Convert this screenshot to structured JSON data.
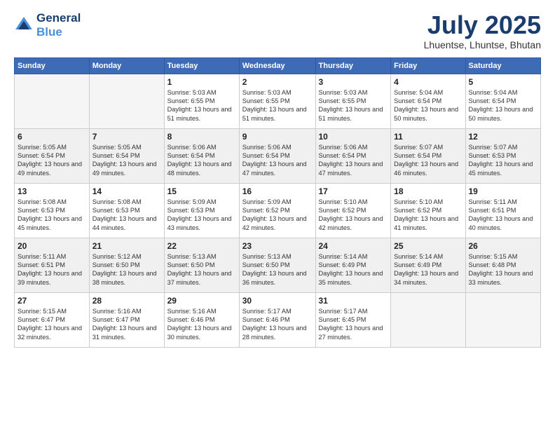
{
  "logo": {
    "line1": "General",
    "line2": "Blue"
  },
  "title": {
    "month_year": "July 2025",
    "location": "Lhuentse, Lhuntse, Bhutan"
  },
  "weekdays": [
    "Sunday",
    "Monday",
    "Tuesday",
    "Wednesday",
    "Thursday",
    "Friday",
    "Saturday"
  ],
  "weeks": [
    [
      {
        "day": "",
        "info": ""
      },
      {
        "day": "",
        "info": ""
      },
      {
        "day": "1",
        "info": "Sunrise: 5:03 AM\nSunset: 6:55 PM\nDaylight: 13 hours and 51 minutes."
      },
      {
        "day": "2",
        "info": "Sunrise: 5:03 AM\nSunset: 6:55 PM\nDaylight: 13 hours and 51 minutes."
      },
      {
        "day": "3",
        "info": "Sunrise: 5:03 AM\nSunset: 6:55 PM\nDaylight: 13 hours and 51 minutes."
      },
      {
        "day": "4",
        "info": "Sunrise: 5:04 AM\nSunset: 6:54 PM\nDaylight: 13 hours and 50 minutes."
      },
      {
        "day": "5",
        "info": "Sunrise: 5:04 AM\nSunset: 6:54 PM\nDaylight: 13 hours and 50 minutes."
      }
    ],
    [
      {
        "day": "6",
        "info": "Sunrise: 5:05 AM\nSunset: 6:54 PM\nDaylight: 13 hours and 49 minutes."
      },
      {
        "day": "7",
        "info": "Sunrise: 5:05 AM\nSunset: 6:54 PM\nDaylight: 13 hours and 49 minutes."
      },
      {
        "day": "8",
        "info": "Sunrise: 5:06 AM\nSunset: 6:54 PM\nDaylight: 13 hours and 48 minutes."
      },
      {
        "day": "9",
        "info": "Sunrise: 5:06 AM\nSunset: 6:54 PM\nDaylight: 13 hours and 47 minutes."
      },
      {
        "day": "10",
        "info": "Sunrise: 5:06 AM\nSunset: 6:54 PM\nDaylight: 13 hours and 47 minutes."
      },
      {
        "day": "11",
        "info": "Sunrise: 5:07 AM\nSunset: 6:54 PM\nDaylight: 13 hours and 46 minutes."
      },
      {
        "day": "12",
        "info": "Sunrise: 5:07 AM\nSunset: 6:53 PM\nDaylight: 13 hours and 45 minutes."
      }
    ],
    [
      {
        "day": "13",
        "info": "Sunrise: 5:08 AM\nSunset: 6:53 PM\nDaylight: 13 hours and 45 minutes."
      },
      {
        "day": "14",
        "info": "Sunrise: 5:08 AM\nSunset: 6:53 PM\nDaylight: 13 hours and 44 minutes."
      },
      {
        "day": "15",
        "info": "Sunrise: 5:09 AM\nSunset: 6:53 PM\nDaylight: 13 hours and 43 minutes."
      },
      {
        "day": "16",
        "info": "Sunrise: 5:09 AM\nSunset: 6:52 PM\nDaylight: 13 hours and 42 minutes."
      },
      {
        "day": "17",
        "info": "Sunrise: 5:10 AM\nSunset: 6:52 PM\nDaylight: 13 hours and 42 minutes."
      },
      {
        "day": "18",
        "info": "Sunrise: 5:10 AM\nSunset: 6:52 PM\nDaylight: 13 hours and 41 minutes."
      },
      {
        "day": "19",
        "info": "Sunrise: 5:11 AM\nSunset: 6:51 PM\nDaylight: 13 hours and 40 minutes."
      }
    ],
    [
      {
        "day": "20",
        "info": "Sunrise: 5:11 AM\nSunset: 6:51 PM\nDaylight: 13 hours and 39 minutes."
      },
      {
        "day": "21",
        "info": "Sunrise: 5:12 AM\nSunset: 6:50 PM\nDaylight: 13 hours and 38 minutes."
      },
      {
        "day": "22",
        "info": "Sunrise: 5:13 AM\nSunset: 6:50 PM\nDaylight: 13 hours and 37 minutes."
      },
      {
        "day": "23",
        "info": "Sunrise: 5:13 AM\nSunset: 6:50 PM\nDaylight: 13 hours and 36 minutes."
      },
      {
        "day": "24",
        "info": "Sunrise: 5:14 AM\nSunset: 6:49 PM\nDaylight: 13 hours and 35 minutes."
      },
      {
        "day": "25",
        "info": "Sunrise: 5:14 AM\nSunset: 6:49 PM\nDaylight: 13 hours and 34 minutes."
      },
      {
        "day": "26",
        "info": "Sunrise: 5:15 AM\nSunset: 6:48 PM\nDaylight: 13 hours and 33 minutes."
      }
    ],
    [
      {
        "day": "27",
        "info": "Sunrise: 5:15 AM\nSunset: 6:47 PM\nDaylight: 13 hours and 32 minutes."
      },
      {
        "day": "28",
        "info": "Sunrise: 5:16 AM\nSunset: 6:47 PM\nDaylight: 13 hours and 31 minutes."
      },
      {
        "day": "29",
        "info": "Sunrise: 5:16 AM\nSunset: 6:46 PM\nDaylight: 13 hours and 30 minutes."
      },
      {
        "day": "30",
        "info": "Sunrise: 5:17 AM\nSunset: 6:46 PM\nDaylight: 13 hours and 28 minutes."
      },
      {
        "day": "31",
        "info": "Sunrise: 5:17 AM\nSunset: 6:45 PM\nDaylight: 13 hours and 27 minutes."
      },
      {
        "day": "",
        "info": ""
      },
      {
        "day": "",
        "info": ""
      }
    ]
  ]
}
